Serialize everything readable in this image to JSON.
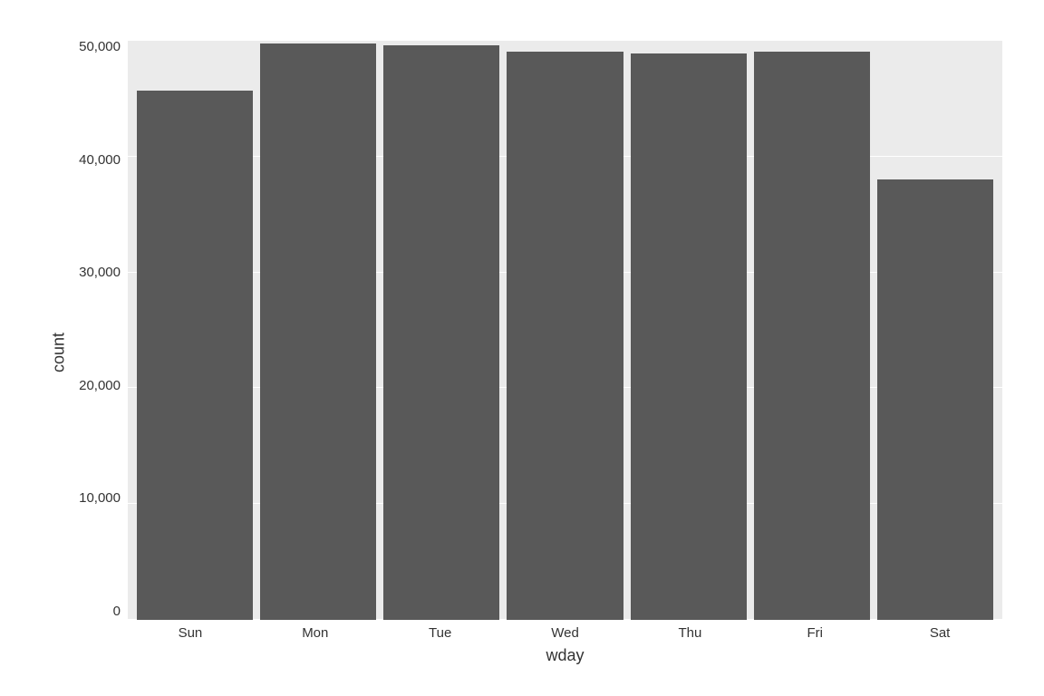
{
  "chart": {
    "y_axis_label": "count",
    "x_axis_label": "wday",
    "y_ticks": [
      "50000",
      "40000",
      "30000",
      "20000",
      "10000",
      "0"
    ],
    "bars": [
      {
        "label": "Sun",
        "value": 45600,
        "max": 50000
      },
      {
        "label": "Mon",
        "value": 49700,
        "max": 50000
      },
      {
        "label": "Tue",
        "value": 49500,
        "max": 50000
      },
      {
        "label": "Wed",
        "value": 49000,
        "max": 50000
      },
      {
        "label": "Thu",
        "value": 48800,
        "max": 50000
      },
      {
        "label": "Fri",
        "value": 49000,
        "max": 50000
      },
      {
        "label": "Sat",
        "value": 38000,
        "max": 50000
      }
    ],
    "bar_color": "#595959",
    "grid_color": "#ffffff",
    "bg_color": "#ebebeb"
  }
}
